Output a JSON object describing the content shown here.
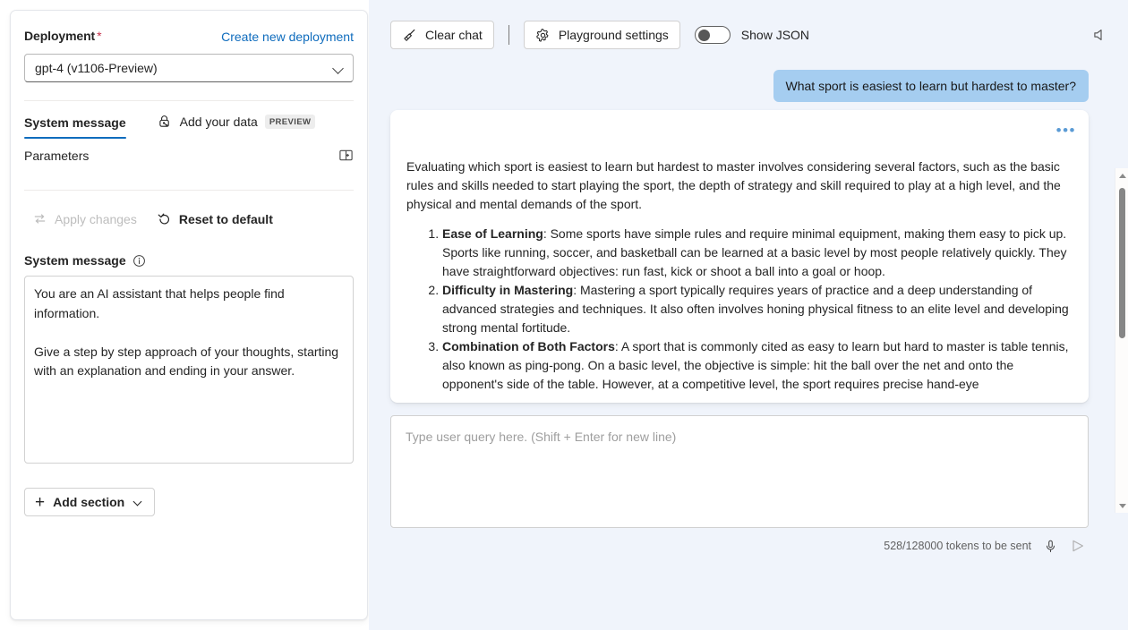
{
  "left_panel": {
    "deployment": {
      "label": "Deployment",
      "required_marker": "*",
      "create_link": "Create new deployment",
      "selected_value": "gpt-4 (v1106-Preview)"
    },
    "tabs": [
      {
        "label": "System message",
        "active": true
      },
      {
        "label": "Add your data",
        "active": false,
        "badge": "PREVIEW",
        "icon": "lock-key-icon"
      }
    ],
    "parameters": {
      "label": "Parameters",
      "collapse_icon": "collapse-panel-icon"
    },
    "actions": {
      "apply_changes": "Apply changes",
      "apply_changes_enabled": false,
      "reset_to_default": "Reset to default",
      "apply_icon": "swap-arrows-icon",
      "reset_icon": "undo-arrow-icon"
    },
    "system_message": {
      "title": "System message",
      "info_icon": "info-circle-icon",
      "value": "You are an AI assistant that helps people find information.\n\nGive a step by step approach of your thoughts, starting with an explanation and ending in your answer."
    },
    "add_section": {
      "label": "Add section",
      "plus_icon": "plus-icon",
      "chevron_icon": "chevron-down-icon"
    }
  },
  "right_panel": {
    "toolbar": {
      "clear_chat": "Clear chat",
      "clear_chat_icon": "broom-icon",
      "playground_settings": "Playground settings",
      "playground_settings_icon": "gear-icon",
      "show_json_label": "Show JSON",
      "show_json_on": false,
      "speaker_icon": "speaker-icon"
    },
    "conversation": [
      {
        "role": "user",
        "text": "What sport is easiest to learn but hardest to master?"
      },
      {
        "role": "assistant",
        "menu_icon": "ellipsis-icon",
        "intro": "Evaluating which sport is easiest to learn but hardest to master involves considering several factors, such as the basic rules and skills needed to start playing the sport, the depth of strategy and skill required to play at a high level, and the physical and mental demands of the sport.",
        "items": [
          {
            "heading": "Ease of Learning",
            "body": ": Some sports have simple rules and require minimal equipment, making them easy to pick up. Sports like running, soccer, and basketball can be learned at a basic level by most people relatively quickly. They have straightforward objectives: run fast, kick or shoot a ball into a goal or hoop."
          },
          {
            "heading": "Difficulty in Mastering",
            "body": ": Mastering a sport typically requires years of practice and a deep understanding of advanced strategies and techniques. It also often involves honing physical fitness to an elite level and developing strong mental fortitude."
          },
          {
            "heading": "Combination of Both Factors",
            "body": ": A sport that is commonly cited as easy to learn but hard to master is table tennis, also known as ping-pong. On a basic level, the objective is simple: hit the ball over the net and onto the opponent's side of the table. However, at a competitive level, the sport requires precise hand-eye"
          }
        ]
      }
    ],
    "query_input": {
      "placeholder": "Type user query here. (Shift + Enter for new line)",
      "value": ""
    },
    "footer": {
      "tokens": "528/128000 tokens to be sent",
      "mic_icon": "microphone-icon",
      "send_icon": "send-icon"
    },
    "scrollbar": {
      "up_icon": "scroll-up-arrow-icon",
      "down_icon": "scroll-down-arrow-icon"
    }
  },
  "colors": {
    "accent": "#0f6cbd",
    "panel_bg": "#f0f4fb",
    "user_bubble": "#a5cdf0",
    "required_star": "#c4314b"
  }
}
